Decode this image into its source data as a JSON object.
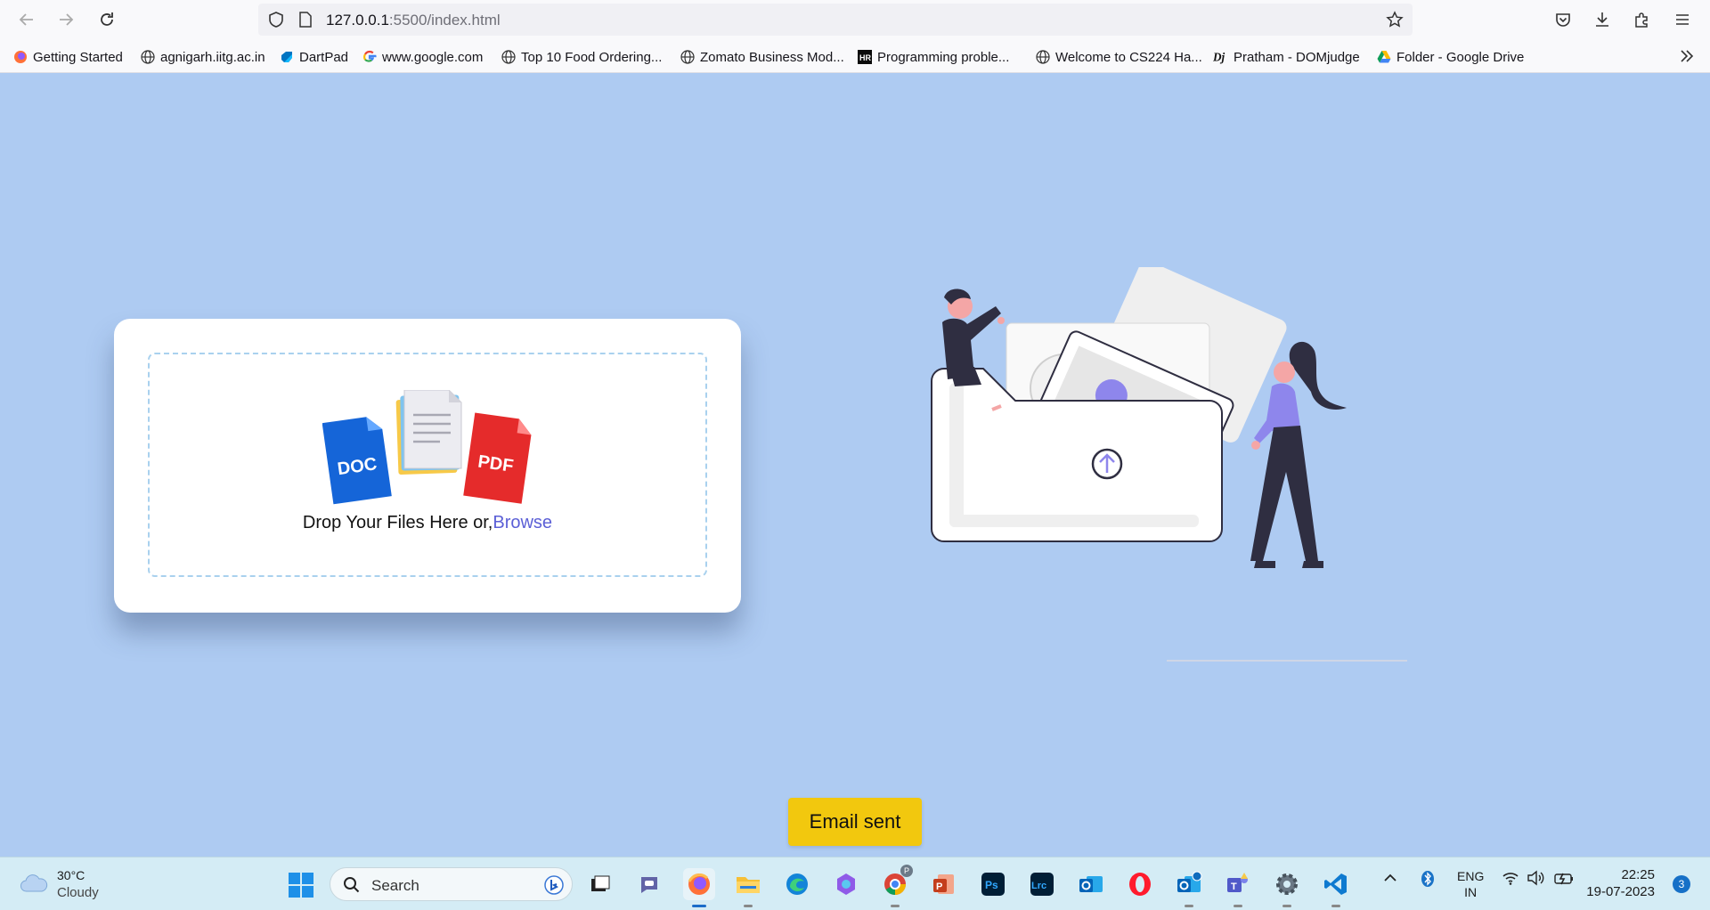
{
  "browser": {
    "url_host": "127.0.0.1",
    "url_rest": ":5500/index.html",
    "bookmarks": [
      {
        "label": "Getting Started",
        "icon": "firefox-icon"
      },
      {
        "label": "agnigarh.iitg.ac.in",
        "icon": "globe-icon"
      },
      {
        "label": "DartPad",
        "icon": "dart-icon"
      },
      {
        "label": "www.google.com",
        "icon": "google-icon"
      },
      {
        "label": "Top 10 Food Ordering...",
        "icon": "globe-icon"
      },
      {
        "label": "Zomato Business Mod...",
        "icon": "globe-icon"
      },
      {
        "label": "Programming proble...",
        "icon": "hackerrank-icon"
      },
      {
        "label": "Welcome to CS224 Ha...",
        "icon": "globe-icon"
      },
      {
        "label": "Pratham - DOMjudge",
        "icon": "domjudge-icon"
      },
      {
        "label": "Folder - Google Drive",
        "icon": "google-drive-icon"
      }
    ]
  },
  "upload": {
    "drop_text": "Drop Your Files Here or,",
    "browse_label": "Browse",
    "doc_label": "DOC",
    "pdf_label": "PDF"
  },
  "toast": {
    "message": "Email sent"
  },
  "taskbar": {
    "weather_temp": "30°C",
    "weather_condition": "Cloudy",
    "search_label": "Search",
    "language_line1": "ENG",
    "language_line2": "IN",
    "time": "22:25",
    "date": "19-07-2023",
    "notification_count": "3",
    "chrome_badge": "P",
    "apps": [
      "task-view-icon",
      "teams-chat-icon",
      "firefox-icon",
      "file-explorer-icon",
      "edge-icon",
      "copilot-icon",
      "chrome-icon",
      "powerpoint-icon",
      "photoshop-icon",
      "lightroom-icon",
      "outlook-icon",
      "opera-icon",
      "outlook-preview-icon",
      "teams-icon",
      "settings-icon",
      "vscode-icon"
    ]
  },
  "colors": {
    "page_background": "#aecbf2",
    "browse_link": "#5b5fd6",
    "toast_background": "#f2c80e",
    "illustration_accent": "#8e86ec",
    "illustration_dark": "#2f2e41"
  }
}
